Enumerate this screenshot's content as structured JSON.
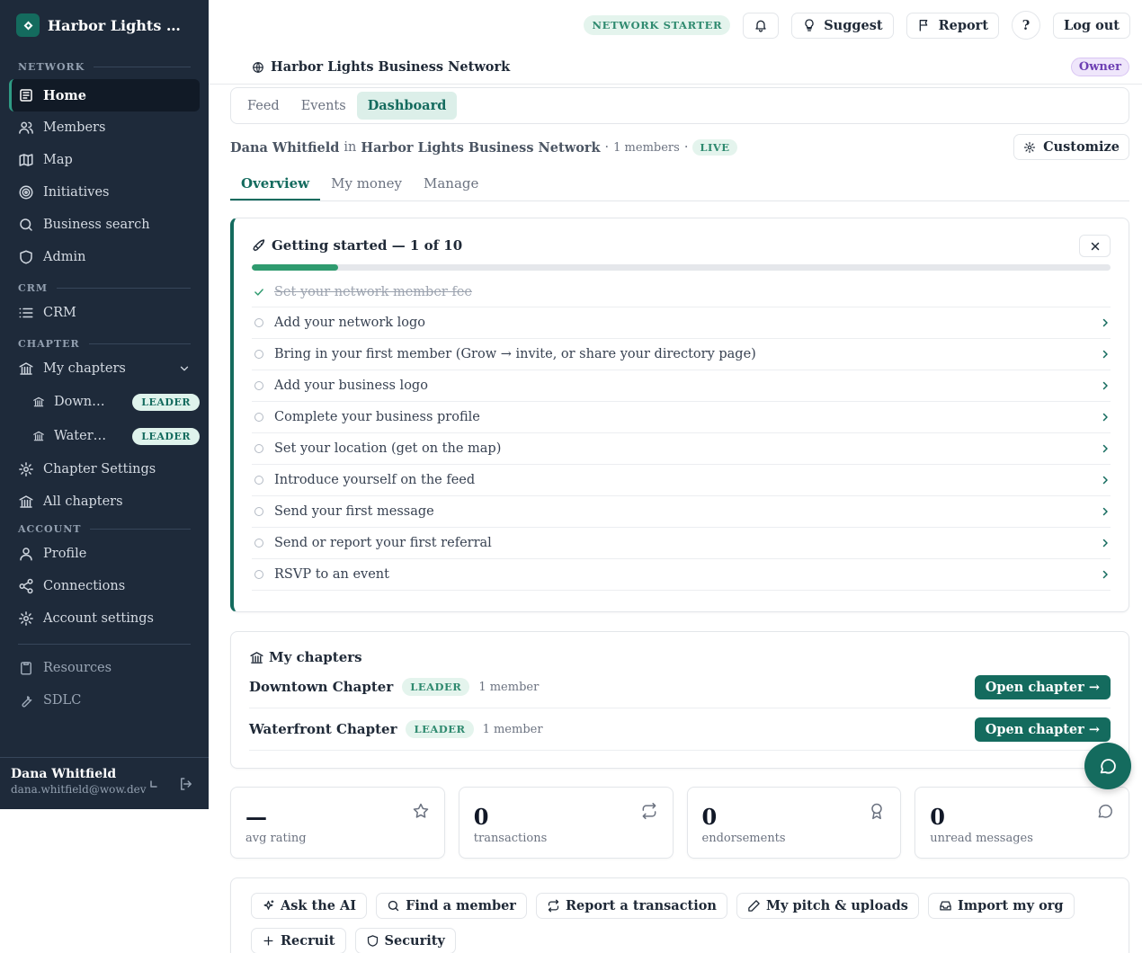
{
  "brand": {
    "name": "Harbor Lights Busi..."
  },
  "sidebar": {
    "sections": {
      "network": "NETWORK",
      "crm": "CRM",
      "chapter": "CHAPTER",
      "account": "ACCOUNT"
    },
    "network_items": [
      "Home",
      "Members",
      "Map",
      "Initiatives",
      "Business search",
      "Admin"
    ],
    "crm_items": [
      "CRM"
    ],
    "chapter": {
      "my_chapters": "My chapters",
      "subs": [
        {
          "label": "Downtown Chapter",
          "badge": "LEADER"
        },
        {
          "label": "Waterfront Chapter",
          "badge": "LEADER"
        }
      ],
      "settings": "Chapter Settings",
      "all": "All chapters"
    },
    "account_items": [
      "Profile",
      "Connections",
      "Account settings"
    ],
    "extra_items": [
      "Resources",
      "SDLC"
    ],
    "user": {
      "name": "Dana Whitfield",
      "email": "dana.whitfield@wow.dev"
    }
  },
  "topbar": {
    "plan": "NETWORK STARTER",
    "suggest": "Suggest",
    "report": "Report",
    "help": "?",
    "logout": "Log out"
  },
  "netbar": {
    "name": "Harbor Lights Business Network",
    "role": "Owner"
  },
  "tabs": [
    "Feed",
    "Events",
    "Dashboard"
  ],
  "context": {
    "user": "Dana Whitfield",
    "in": "in",
    "network": "Harbor Lights Business Network",
    "members": "1 members",
    "status": "LIVE",
    "customize": "Customize"
  },
  "subtabs": [
    "Overview",
    "My money",
    "Manage"
  ],
  "getting_started": {
    "title": "Getting started — 1 of 10",
    "progress": 0.1,
    "tasks": [
      "Set your network member fee",
      "Add your network logo",
      "Bring in your first member (Grow → invite, or share your directory page)",
      "Add your business logo",
      "Complete your business profile",
      "Set your location (get on the map)",
      "Introduce yourself on the feed",
      "Send your first message",
      "Send or report your first referral",
      "RSVP to an event"
    ]
  },
  "my_chapters": {
    "title": "My chapters",
    "rows": [
      {
        "name": "Downtown Chapter",
        "badge": "LEADER",
        "members": "1 member",
        "action": "Open chapter →"
      },
      {
        "name": "Waterfront Chapter",
        "badge": "LEADER",
        "members": "1 member",
        "action": "Open chapter →"
      }
    ]
  },
  "stats": [
    {
      "value": "—",
      "label": "avg rating",
      "icon": "star-icon"
    },
    {
      "value": "0",
      "label": "transactions",
      "icon": "repeat-icon"
    },
    {
      "value": "0",
      "label": "endorsements",
      "icon": "award-icon"
    },
    {
      "value": "0",
      "label": "unread messages",
      "icon": "message-icon"
    }
  ],
  "quick_actions": [
    "Ask the AI",
    "Find a member",
    "Report a transaction",
    "My pitch & uploads",
    "Import my org",
    "Recruit",
    "Security"
  ],
  "colors": {
    "sidebar": "#1e2a3a",
    "accent": "#146b5e",
    "progress": "#2f9b6f"
  }
}
